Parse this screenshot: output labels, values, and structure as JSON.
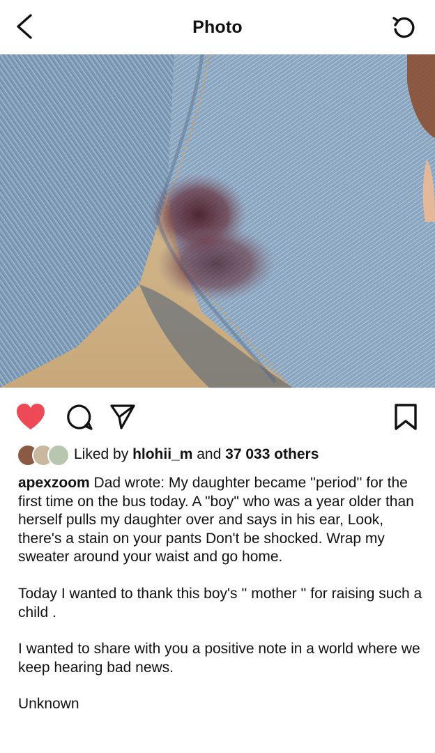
{
  "header": {
    "title": "Photo",
    "back_icon": "chevron-left-icon",
    "refresh_icon": "refresh-icon"
  },
  "post": {
    "image_description_icon": "photo",
    "actions": {
      "like_icon": "heart-filled-icon",
      "comment_icon": "comment-icon",
      "share_icon": "send-icon",
      "save_icon": "bookmark-icon",
      "like_color": "#ed4956"
    },
    "likes": {
      "prefix": "Liked by",
      "user": "hlohii_m",
      "middle": "and",
      "count": "37 033 others"
    },
    "caption": {
      "username": "apexzoom",
      "paragraph1": "Dad wrote: My daughter became ''period'' for the first time on the bus today. A \"boy\" who was a year older than herself pulls my daughter over and says in his ear, Look, there's a stain on your pants Don't be shocked. Wrap my sweater around your waist and go home.",
      "paragraph2": "Today I wanted to thank this boy's '' mother '' for raising such a child .",
      "paragraph3": "I wanted to share with you a positive note in a world where we keep hearing bad news.",
      "paragraph4": "Unknown"
    }
  }
}
